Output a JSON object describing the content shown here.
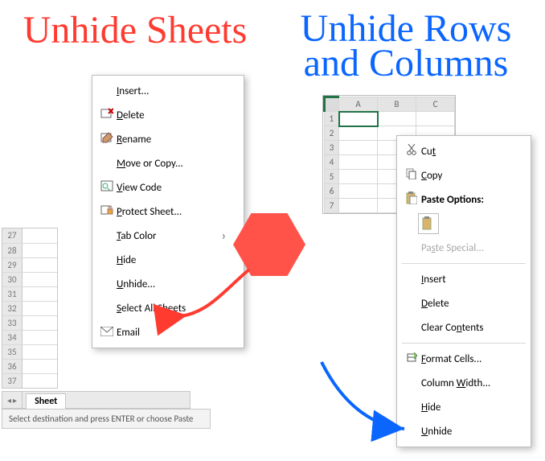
{
  "titles": {
    "left": "Unhide Sheets",
    "right_line1": "Unhide Rows",
    "right_line2": "and Columns"
  },
  "left_grid_rows": [
    "27",
    "28",
    "29",
    "30",
    "31",
    "32",
    "33",
    "34",
    "35",
    "36",
    "37"
  ],
  "sheet_tab_label": "Sheet",
  "status_text": "Select destination and press ENTER or choose Paste",
  "right_grid": {
    "cols": [
      "A",
      "B",
      "C"
    ],
    "rows": [
      "1",
      "2",
      "3",
      "4",
      "5",
      "6",
      "7"
    ]
  },
  "menu_left": [
    {
      "icon": "",
      "label": "Insert...",
      "key": "I"
    },
    {
      "icon": "del",
      "label": "Delete",
      "key": "D"
    },
    {
      "icon": "ren",
      "label": "Rename",
      "key": "R"
    },
    {
      "icon": "",
      "label": "Move or Copy...",
      "key": "M"
    },
    {
      "icon": "code",
      "label": "View Code",
      "key": "V"
    },
    {
      "icon": "prot",
      "label": "Protect Sheet...",
      "key": "P"
    },
    {
      "icon": "",
      "label": "Tab Color",
      "key": "T",
      "submenu": true
    },
    {
      "icon": "",
      "label": "Hide",
      "key": "H"
    },
    {
      "icon": "",
      "label": "Unhide...",
      "key": "U"
    },
    {
      "icon": "",
      "label": "Select All Sheets",
      "key": "S"
    },
    {
      "icon": "mail",
      "label": "Email",
      "key": ""
    }
  ],
  "menu_right": [
    {
      "icon": "cut",
      "label": "Cut",
      "key": "t"
    },
    {
      "icon": "copy",
      "label": "Copy",
      "key": "C"
    },
    {
      "icon": "paste",
      "label": "Paste Options:",
      "key": "",
      "bold": true
    },
    {
      "icon": "pasteicon"
    },
    {
      "icon": "",
      "label": "Paste Special...",
      "key": "S",
      "disabled": true
    },
    {
      "sep": true
    },
    {
      "icon": "",
      "label": "Insert",
      "key": "I"
    },
    {
      "icon": "",
      "label": "Delete",
      "key": "D"
    },
    {
      "icon": "",
      "label": "Clear Contents",
      "key": "N"
    },
    {
      "sep": true
    },
    {
      "icon": "fmt",
      "label": "Format Cells...",
      "key": "F"
    },
    {
      "icon": "",
      "label": "Column Width...",
      "key": "W"
    },
    {
      "icon": "",
      "label": "Hide",
      "key": "H"
    },
    {
      "icon": "",
      "label": "Unhide",
      "key": "U"
    }
  ]
}
